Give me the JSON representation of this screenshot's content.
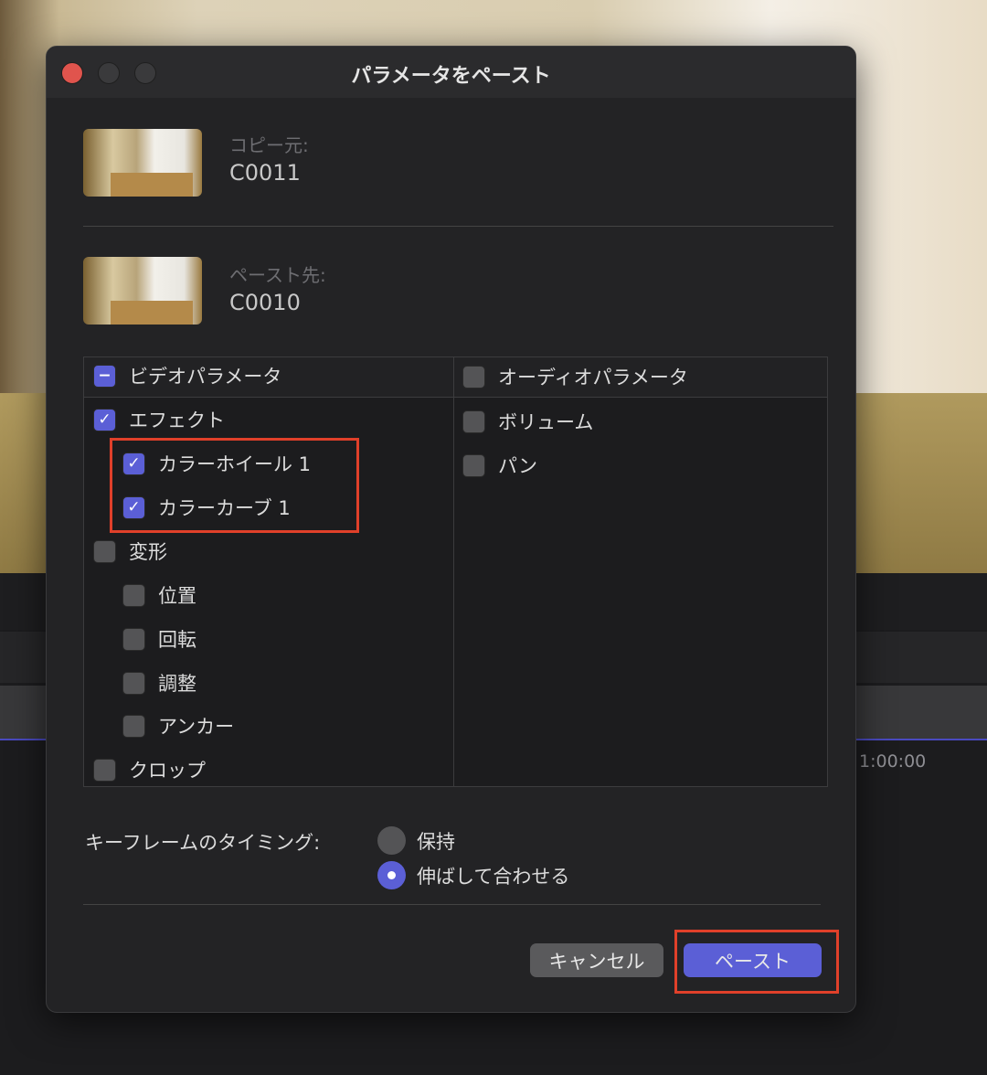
{
  "dialog": {
    "title": "パラメータをペースト"
  },
  "source": {
    "label": "コピー元:",
    "clip": "C0011"
  },
  "destination": {
    "label": "ペースト先:",
    "clip": "C0010"
  },
  "video": {
    "header": "ビデオパラメータ",
    "items": [
      {
        "label": "エフェクト",
        "checked": true
      },
      {
        "label": "カラーホイール 1",
        "checked": true
      },
      {
        "label": "カラーカーブ 1",
        "checked": true
      },
      {
        "label": "変形",
        "checked": false
      },
      {
        "label": "位置",
        "checked": false
      },
      {
        "label": "回転",
        "checked": false
      },
      {
        "label": "調整",
        "checked": false
      },
      {
        "label": "アンカー",
        "checked": false
      },
      {
        "label": "クロップ",
        "checked": false
      }
    ]
  },
  "audio": {
    "header": "オーディオパラメータ",
    "items": [
      {
        "label": "ボリューム",
        "checked": false
      },
      {
        "label": "パン",
        "checked": false
      }
    ]
  },
  "keyframe": {
    "label": "キーフレームのタイミング:",
    "options": [
      "保持",
      "伸ばして合わせる"
    ],
    "selected": "伸ばして合わせる"
  },
  "buttons": {
    "cancel": "キャンセル",
    "paste": "ペースト"
  },
  "background": {
    "timecode": "1:00:00"
  },
  "colors": {
    "accent": "#5b5fd6",
    "highlight": "#e0402a",
    "close": "#e0544d"
  }
}
